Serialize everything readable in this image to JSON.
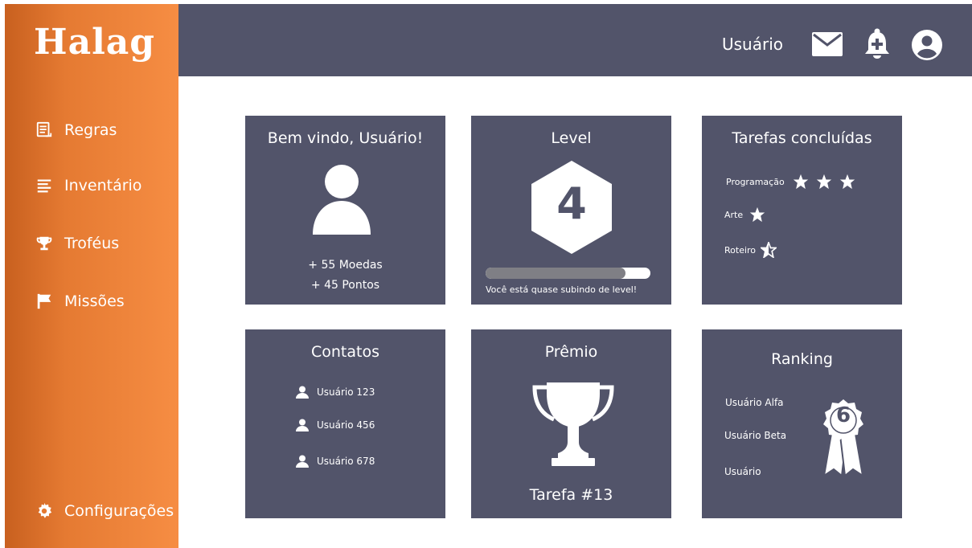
{
  "app": {
    "logo": "Halag"
  },
  "sidebar": {
    "items": [
      {
        "label": "Regras"
      },
      {
        "label": "Inventário"
      },
      {
        "label": "Troféus"
      },
      {
        "label": "Missões"
      }
    ],
    "settings": {
      "label": "Configurações"
    }
  },
  "header": {
    "user_label": "Usuário"
  },
  "colors": {
    "panel": "#52546a",
    "accent": "#f68d43",
    "text": "#ffffff"
  },
  "welcome": {
    "title": "Bem vindo, Usuário!",
    "coins": "+ 55 Moedas",
    "points": "+ 45 Pontos"
  },
  "level": {
    "title": "Level",
    "value": "4",
    "progress": 0.85,
    "message": "Você está quase subindo de level!"
  },
  "tasks": {
    "title": "Tarefas concluídas",
    "items": [
      {
        "label": "Programação",
        "stars": 3
      },
      {
        "label": "Arte",
        "stars": 1
      },
      {
        "label": "Roteiro",
        "stars": 0.5
      }
    ]
  },
  "contacts": {
    "title": "Contatos",
    "items": [
      {
        "name": "Usuário 123"
      },
      {
        "name": "Usuário 456"
      },
      {
        "name": "Usuário 678"
      }
    ]
  },
  "prize": {
    "title": "Prêmio",
    "task": "Tarefa #13"
  },
  "ranking": {
    "title": "Ranking",
    "position": "6",
    "items": [
      {
        "name": "Usuário  Alfa"
      },
      {
        "name": "Usuário Beta"
      },
      {
        "name": "Usuário"
      }
    ]
  }
}
